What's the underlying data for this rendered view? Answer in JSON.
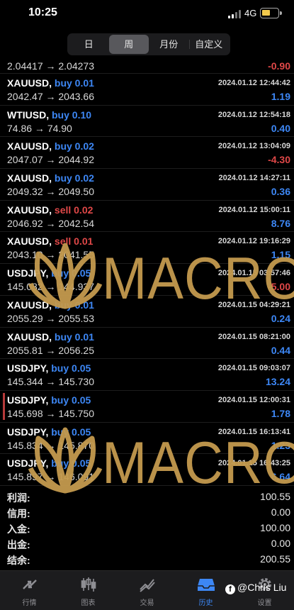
{
  "status": {
    "time": "10:25",
    "network": "4G"
  },
  "segments": [
    "日",
    "周",
    "月份",
    "自定义"
  ],
  "active_segment": "周",
  "first_row": {
    "prices": "2.04417 → 2.04273",
    "pl": "-0.90"
  },
  "trades": [
    {
      "symbol": "XAUUSD,",
      "action": "buy 0.01",
      "type": "buy",
      "time": "2024.01.12 12:44:42",
      "prices": "2042.47 → 2043.66",
      "pl": "1.19"
    },
    {
      "symbol": "WTIUSD,",
      "action": "buy 0.10",
      "type": "buy",
      "time": "2024.01.12 12:54:18",
      "prices": "74.86 → 74.90",
      "pl": "0.40"
    },
    {
      "symbol": "XAUUSD,",
      "action": "buy 0.02",
      "type": "buy",
      "time": "2024.01.12 13:04:09",
      "prices": "2047.07 → 2044.92",
      "pl": "-4.30"
    },
    {
      "symbol": "XAUUSD,",
      "action": "buy 0.02",
      "type": "buy",
      "time": "2024.01.12 14:27:11",
      "prices": "2049.32 → 2049.50",
      "pl": "0.36"
    },
    {
      "symbol": "XAUUSD,",
      "action": "sell 0.02",
      "type": "sell",
      "time": "2024.01.12 15:00:11",
      "prices": "2046.92 → 2042.54",
      "pl": "8.76"
    },
    {
      "symbol": "XAUUSD,",
      "action": "sell 0.01",
      "type": "sell",
      "time": "2024.01.12 19:16:29",
      "prices": "2043.10 → 2041.55",
      "pl": "1.15"
    },
    {
      "symbol": "USDJPY,",
      "action": "buy 0.05",
      "type": "buy",
      "time": "2024.01.15 03:57:46",
      "prices": "145.082 → 144.937",
      "pl": "-5.00"
    },
    {
      "symbol": "XAUUSD,",
      "action": "buy 0.01",
      "type": "buy",
      "time": "2024.01.15 04:29:21",
      "prices": "2055.29 → 2055.53",
      "pl": "0.24"
    },
    {
      "symbol": "XAUUSD,",
      "action": "buy 0.01",
      "type": "buy",
      "time": "2024.01.15 08:21:00",
      "prices": "2055.81 → 2056.25",
      "pl": "0.44"
    },
    {
      "symbol": "USDJPY,",
      "action": "buy 0.05",
      "type": "buy",
      "time": "2024.01.15 09:03:07",
      "prices": "145.344 → 145.730",
      "pl": "13.24"
    },
    {
      "symbol": "USDJPY,",
      "action": "buy 0.05",
      "type": "buy",
      "time": "2024.01.15 12:00:31",
      "prices": "145.698 → 145.750",
      "pl": "1.78"
    },
    {
      "symbol": "USDJPY,",
      "action": "buy 0.05",
      "type": "buy",
      "time": "2024.01.15 16:13:41",
      "prices": "145.834 → 145.870",
      "pl": "1.23"
    },
    {
      "symbol": "USDJPY,",
      "action": "buy 0.05",
      "type": "buy",
      "time": "2024.01.15 16:43:25",
      "prices": "145.897 → 146.091",
      "pl": "6.64"
    }
  ],
  "summary": [
    {
      "label": "利润:",
      "value": "100.55"
    },
    {
      "label": "信用:",
      "value": "0.00"
    },
    {
      "label": "入金:",
      "value": "100.00"
    },
    {
      "label": "出金:",
      "value": "0.00"
    },
    {
      "label": "结余:",
      "value": "200.55"
    }
  ],
  "tabs": [
    {
      "label": "行情",
      "icon": "quotes-icon"
    },
    {
      "label": "图表",
      "icon": "candlestick-chart-icon"
    },
    {
      "label": "交易",
      "icon": "trade-chart-icon"
    },
    {
      "label": "历史",
      "icon": "history-inbox-icon",
      "active": true
    },
    {
      "label": "设置",
      "icon": "gear-icon"
    }
  ],
  "watermark": {
    "text": "MACRO",
    "color": "#c49a4e"
  },
  "credit": {
    "text": "@Chris Liu"
  },
  "colors": {
    "buy": "#3d87f5",
    "sell": "#e04848",
    "background": "#000000",
    "accent": "#3d87f5"
  }
}
